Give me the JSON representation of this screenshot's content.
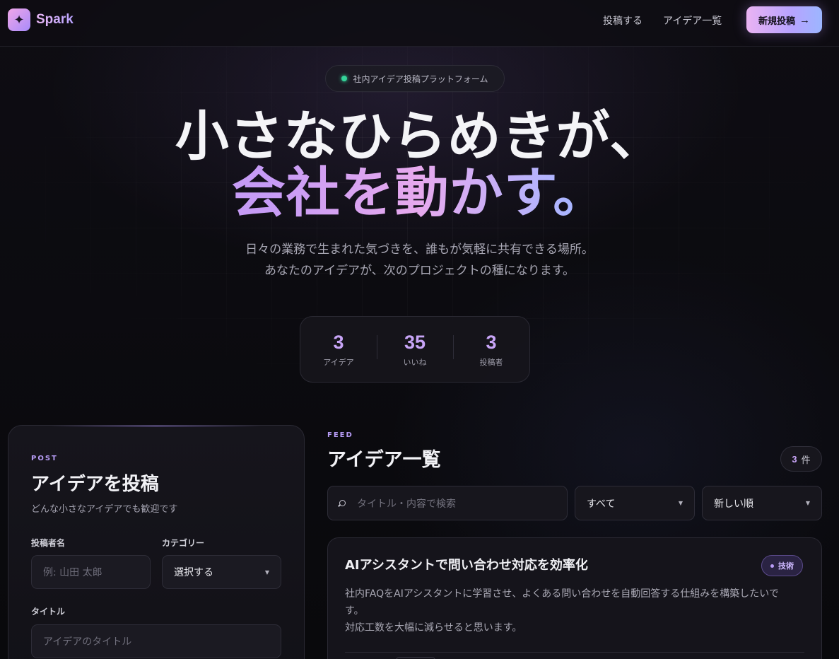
{
  "nav": {
    "brand": "Spark",
    "links": [
      "投稿する",
      "アイデア一覧"
    ],
    "cta_label": "新規投稿",
    "cta_arrow": "→"
  },
  "hero": {
    "pill_text": "社内アイデア投稿プラットフォーム",
    "title_line1": "小さなひらめきが、",
    "title_line2": "会社を動かす。",
    "subtitle_line1": "日々の業務で生まれた気づきを、誰もが気軽に共有できる場所。",
    "subtitle_line2": "あなたのアイデアが、次のプロジェクトの種になります。"
  },
  "stats": [
    {
      "value": "3",
      "label": "アイデア"
    },
    {
      "value": "35",
      "label": "いいね"
    },
    {
      "value": "3",
      "label": "投稿者"
    }
  ],
  "post_form": {
    "eyebrow": "POST",
    "title": "アイデアを投稿",
    "subtitle": "どんな小さなアイデアでも歓迎です",
    "author_label": "投稿者名",
    "author_placeholder": "例: 山田 太郎",
    "category_label": "カテゴリー",
    "category_value": "選択する",
    "title_label": "タイトル",
    "title_placeholder": "アイデアのタイトル"
  },
  "feed": {
    "eyebrow": "FEED",
    "title": "アイデア一覧",
    "count_value": "3",
    "count_unit": "件",
    "search_placeholder": "タイトル・内容で検索",
    "filter_value": "すべて",
    "sort_value": "新しい順",
    "items": [
      {
        "title": "AIアシスタントで問い合わせ対応を効率化",
        "category": "技術",
        "body_line1": "社内FAQをAIアシスタントに学習させ、よくある問い合わせを自動回答する仕組みを構築したいで",
        "body_line2": "す。",
        "body_line3": "対応工数を大幅に減らせると思います。"
      }
    ]
  },
  "colors": {
    "accent_purple": "#c8a5f7",
    "accent_pink": "#e7a9ee",
    "accent_blue": "#a9b5ff",
    "status_green": "#34d399",
    "background": "#0c0b10"
  }
}
